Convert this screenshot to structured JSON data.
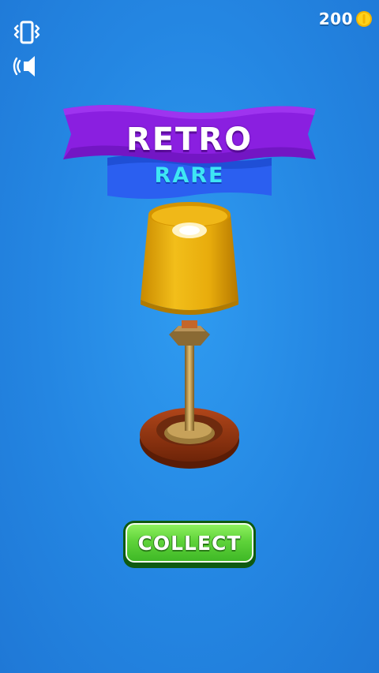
{
  "hud": {
    "vibration_icon": "phone-vibrate-icon",
    "sound_icon": "speaker-icon",
    "coins": "200",
    "coin_icon": "coin-icon"
  },
  "reward": {
    "name": "RETRO",
    "rarity": "RARE",
    "item_icon": "table-lamp"
  },
  "actions": {
    "collect_label": "COLLECT"
  },
  "colors": {
    "background": "#2486e2",
    "banner_primary": "#8a1fe0",
    "banner_secondary": "#2b5ff0",
    "rarity_text": "#3ee6f4",
    "button_green": "#5fd33a",
    "coin": "#ffcc00"
  }
}
